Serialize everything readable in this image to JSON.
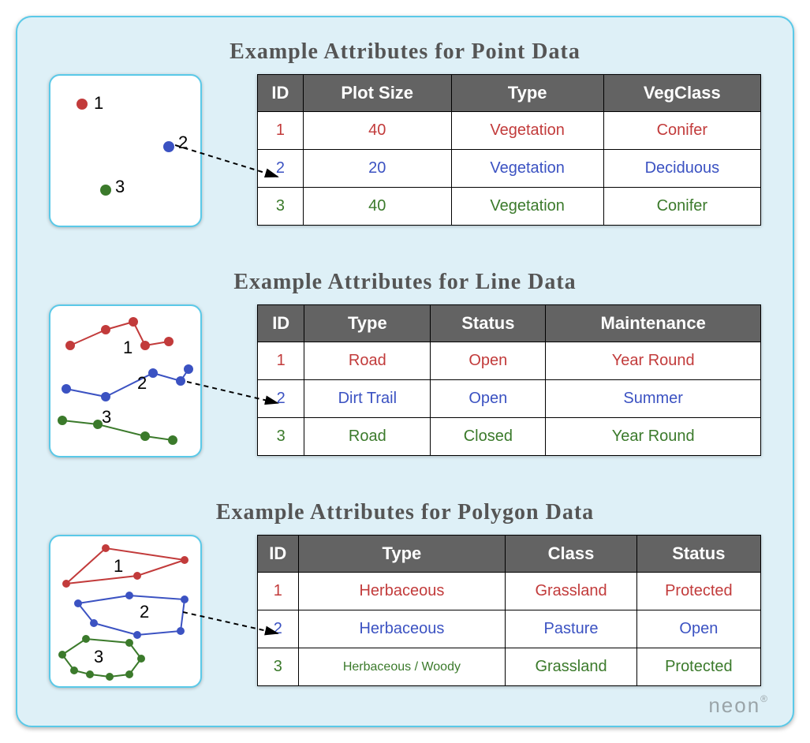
{
  "sections": {
    "point": {
      "title": "Example Attributes for Point Data",
      "headers": [
        "ID",
        "Plot Size",
        "Type",
        "VegClass"
      ],
      "rows": [
        [
          "1",
          "40",
          "Vegetation",
          "Conifer"
        ],
        [
          "2",
          "20",
          "Vegetation",
          "Deciduous"
        ],
        [
          "3",
          "40",
          "Vegetation",
          "Conifer"
        ]
      ],
      "labels": [
        "1",
        "2",
        "3"
      ]
    },
    "line": {
      "title": "Example Attributes for Line Data",
      "headers": [
        "ID",
        "Type",
        "Status",
        "Maintenance"
      ],
      "rows": [
        [
          "1",
          "Road",
          "Open",
          "Year Round"
        ],
        [
          "2",
          "Dirt Trail",
          "Open",
          "Summer"
        ],
        [
          "3",
          "Road",
          "Closed",
          "Year Round"
        ]
      ],
      "labels": [
        "1",
        "2",
        "3"
      ]
    },
    "polygon": {
      "title": "Example Attributes for Polygon Data",
      "headers": [
        "ID",
        "Type",
        "Class",
        "Status"
      ],
      "rows": [
        [
          "1",
          "Herbaceous",
          "Grassland",
          "Protected"
        ],
        [
          "2",
          "Herbaceous",
          "Pasture",
          "Open"
        ],
        [
          "3",
          "Herbaceous / Woody",
          "Grassland",
          "Protected"
        ]
      ],
      "labels": [
        "1",
        "2",
        "3"
      ]
    }
  },
  "colors": {
    "red": "#c23b3b",
    "blue": "#3b52c2",
    "green": "#3b7a2b"
  },
  "logo": "neon"
}
